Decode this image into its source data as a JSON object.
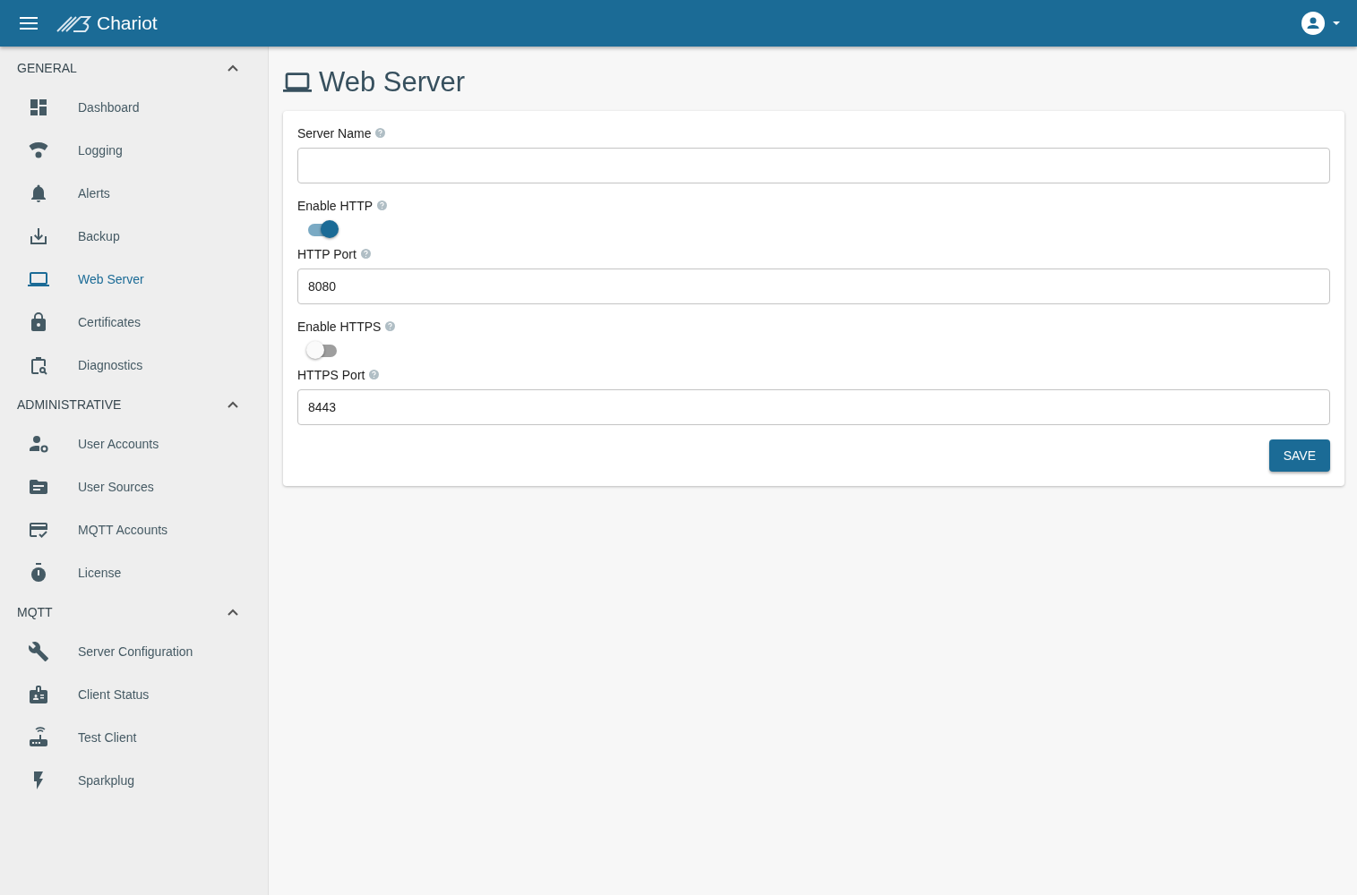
{
  "header": {
    "title": "Chariot"
  },
  "sidebar": {
    "sections": [
      {
        "title": "GENERAL",
        "expanded": true,
        "items": [
          {
            "label": "Dashboard",
            "selected": false
          },
          {
            "label": "Logging",
            "selected": false
          },
          {
            "label": "Alerts",
            "selected": false
          },
          {
            "label": "Backup",
            "selected": false
          },
          {
            "label": "Web Server",
            "selected": true
          },
          {
            "label": "Certificates",
            "selected": false
          },
          {
            "label": "Diagnostics",
            "selected": false
          }
        ]
      },
      {
        "title": "ADMINISTRATIVE",
        "expanded": true,
        "items": [
          {
            "label": "User Accounts",
            "selected": false
          },
          {
            "label": "User Sources",
            "selected": false
          },
          {
            "label": "MQTT Accounts",
            "selected": false
          },
          {
            "label": "License",
            "selected": false
          }
        ]
      },
      {
        "title": "MQTT",
        "expanded": true,
        "items": [
          {
            "label": "Server Configuration",
            "selected": false
          },
          {
            "label": "Client Status",
            "selected": false
          },
          {
            "label": "Test Client",
            "selected": false
          },
          {
            "label": "Sparkplug",
            "selected": false
          }
        ]
      }
    ]
  },
  "page": {
    "title": "Web Server"
  },
  "form": {
    "fields": [
      {
        "kind": "text",
        "label": "Server Name"
      },
      {
        "kind": "toggle",
        "label": "Enable HTTP",
        "on": true
      },
      {
        "kind": "text",
        "label": "HTTP Port",
        "value": "8080"
      },
      {
        "kind": "toggle",
        "label": "Enable HTTPS",
        "on": false
      },
      {
        "kind": "text",
        "label": "HTTPS Port",
        "value": "8443"
      }
    ],
    "button": "SAVE"
  }
}
